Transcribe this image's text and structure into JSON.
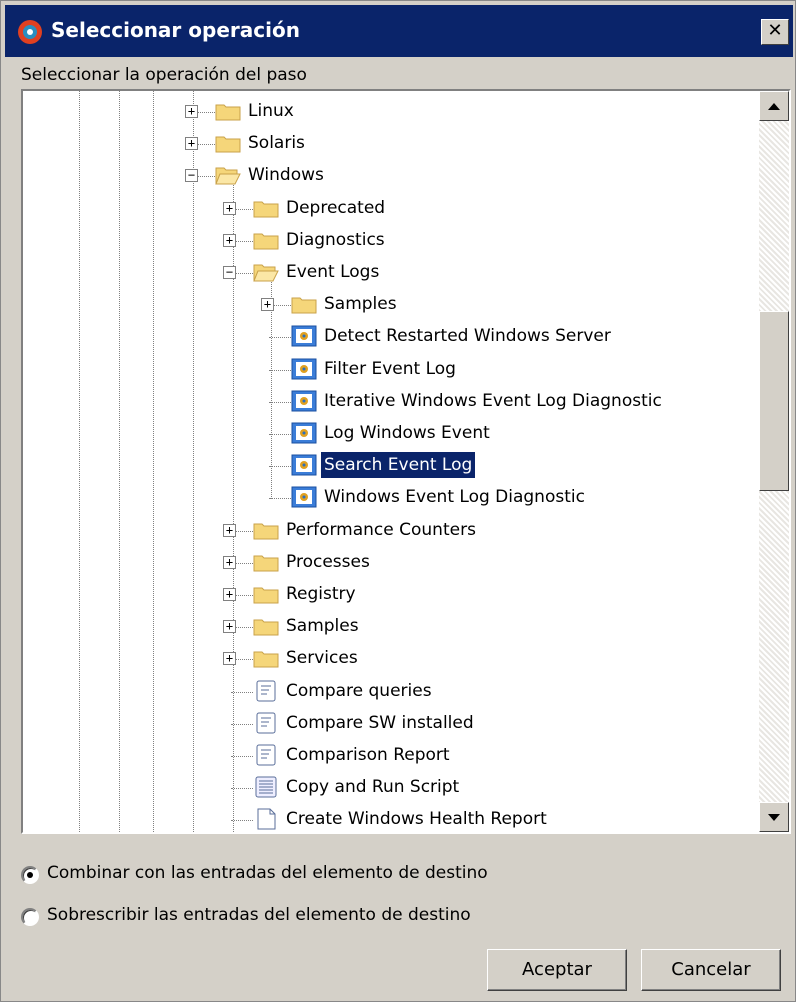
{
  "window": {
    "title": "Seleccionar operación",
    "close_label": "✕"
  },
  "caption": "Seleccionar la operación del paso",
  "tree": {
    "rows": [
      {
        "label": "Linux",
        "icon": "folder-closed",
        "expander": "+"
      },
      {
        "label": "Solaris",
        "icon": "folder-closed",
        "expander": "+"
      },
      {
        "label": "Windows",
        "icon": "folder-open",
        "expander": "−"
      },
      {
        "label": "Deprecated",
        "icon": "folder-closed",
        "expander": "+"
      },
      {
        "label": "Diagnostics",
        "icon": "folder-closed",
        "expander": "+"
      },
      {
        "label": "Event Logs",
        "icon": "folder-open",
        "expander": "−"
      },
      {
        "label": "Samples",
        "icon": "folder-closed",
        "expander": "+"
      },
      {
        "label": "Detect Restarted Windows Server",
        "icon": "operation-icon"
      },
      {
        "label": "Filter Event Log",
        "icon": "operation-icon"
      },
      {
        "label": "Iterative Windows Event Log Diagnostic",
        "icon": "operation-icon"
      },
      {
        "label": "Log Windows Event",
        "icon": "operation-icon"
      },
      {
        "label": "Search Event Log",
        "icon": "operation-icon",
        "selected": true
      },
      {
        "label": "Windows Event Log Diagnostic",
        "icon": "operation-icon"
      },
      {
        "label": "Performance Counters",
        "icon": "folder-closed",
        "expander": "+"
      },
      {
        "label": "Processes",
        "icon": "folder-closed",
        "expander": "+"
      },
      {
        "label": "Registry",
        "icon": "folder-closed",
        "expander": "+"
      },
      {
        "label": "Samples",
        "icon": "folder-closed",
        "expander": "+"
      },
      {
        "label": "Services",
        "icon": "folder-closed",
        "expander": "+"
      },
      {
        "label": "Compare queries",
        "icon": "script-icon"
      },
      {
        "label": "Compare SW installed",
        "icon": "script-icon"
      },
      {
        "label": "Comparison Report",
        "icon": "script-icon"
      },
      {
        "label": "Copy and Run Script",
        "icon": "list-script-icon"
      },
      {
        "label": "Create Windows Health Report",
        "icon": "document-icon"
      }
    ]
  },
  "options": {
    "merge_label": "Combinar con las entradas del elemento de destino",
    "overwrite_label": "Sobrescribir las entradas del elemento de destino",
    "selected": "merge"
  },
  "buttons": {
    "accept": "Aceptar",
    "cancel": "Cancelar"
  },
  "colors": {
    "title_bar": "#0a246a",
    "selection": "#0a246a",
    "folder": "#f5d67a"
  }
}
